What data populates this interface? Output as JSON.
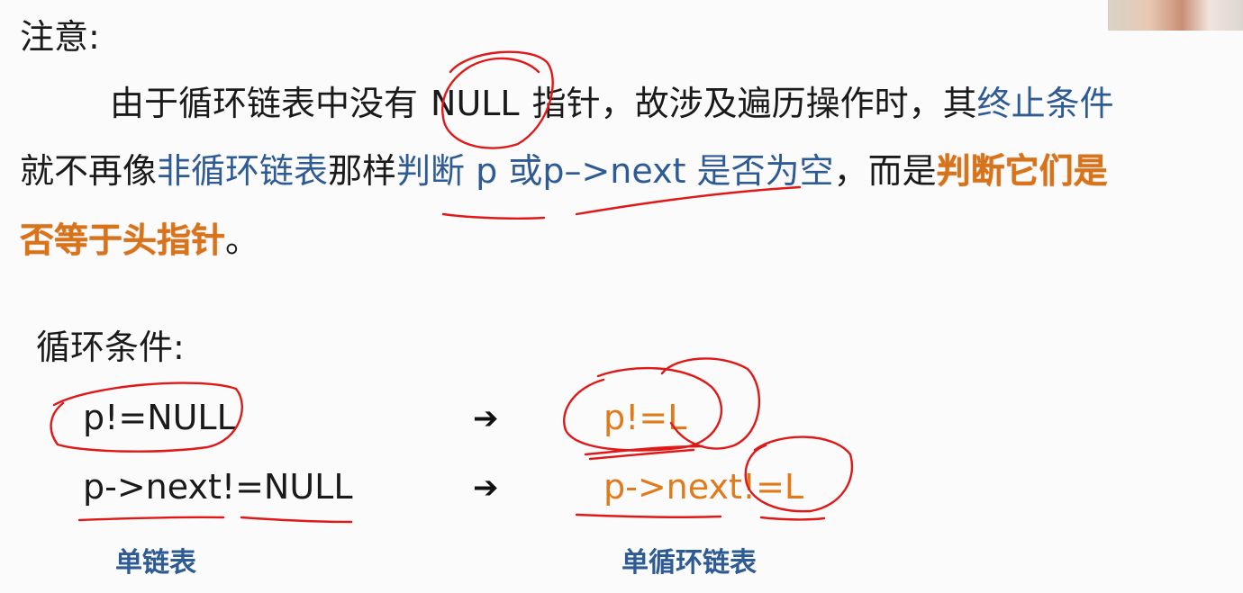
{
  "note": {
    "heading": "注意:",
    "para": {
      "s1": "由于循环链表中没有",
      "null": "NULL",
      "s2": "指针，故涉及遍历操作时，其",
      "term": "终止条件",
      "s3": "就不再像",
      "noncircular": "非循环链表",
      "s4": "那样",
      "judge": "判断 p 或p–>next 是否为空",
      "s5": "，而是",
      "key1": "判断它们是",
      "key2": "否等于头指针",
      "end": "。"
    }
  },
  "loop": {
    "heading": "循环条件:",
    "rows": [
      {
        "left": "p!=NULL",
        "arrow": "➔",
        "right": "p!=L"
      },
      {
        "left": "p->next!=NULL",
        "arrow": "➔",
        "right": "p->next!=L"
      }
    ],
    "captions": {
      "left": "单链表",
      "right": "单循环链表"
    }
  },
  "colors": {
    "blue": "#2e5b94",
    "orange": "#e07b1c",
    "annotation": "#e01818"
  },
  "icons": [
    "arrow-right-icon",
    "arrow-right-icon"
  ]
}
